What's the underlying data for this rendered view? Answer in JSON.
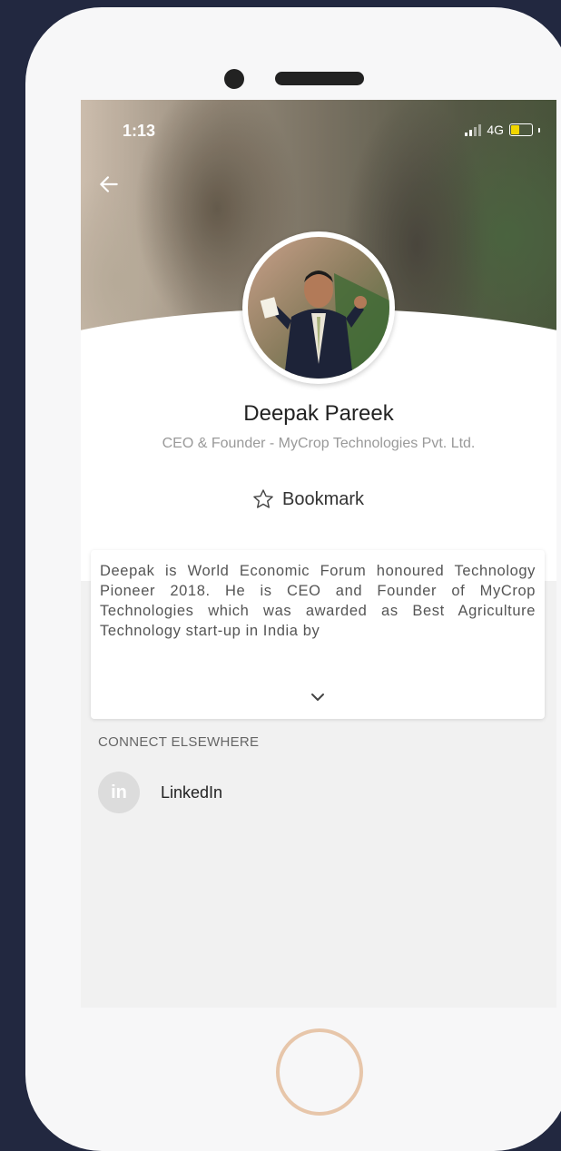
{
  "status_bar": {
    "time": "1:13",
    "network": "4G"
  },
  "profile": {
    "name": "Deepak Pareek",
    "title": "CEO & Founder - MyCrop Technologies Pvt. Ltd.",
    "bookmark_label": "Bookmark"
  },
  "bio": {
    "text": "Deepak is World Economic Forum honoured Technology Pioneer 2018. He is CEO and Founder of MyCrop Technologies which was awarded as Best Agriculture Technology start-up in India by"
  },
  "connect": {
    "heading": "CONNECT ELSEWHERE",
    "items": [
      {
        "label": "LinkedIn",
        "icon": "linkedin-icon",
        "icon_text": "in"
      }
    ]
  },
  "colors": {
    "background": "#222840",
    "battery": "#f2d600",
    "home_ring": "#e7c6aa"
  }
}
